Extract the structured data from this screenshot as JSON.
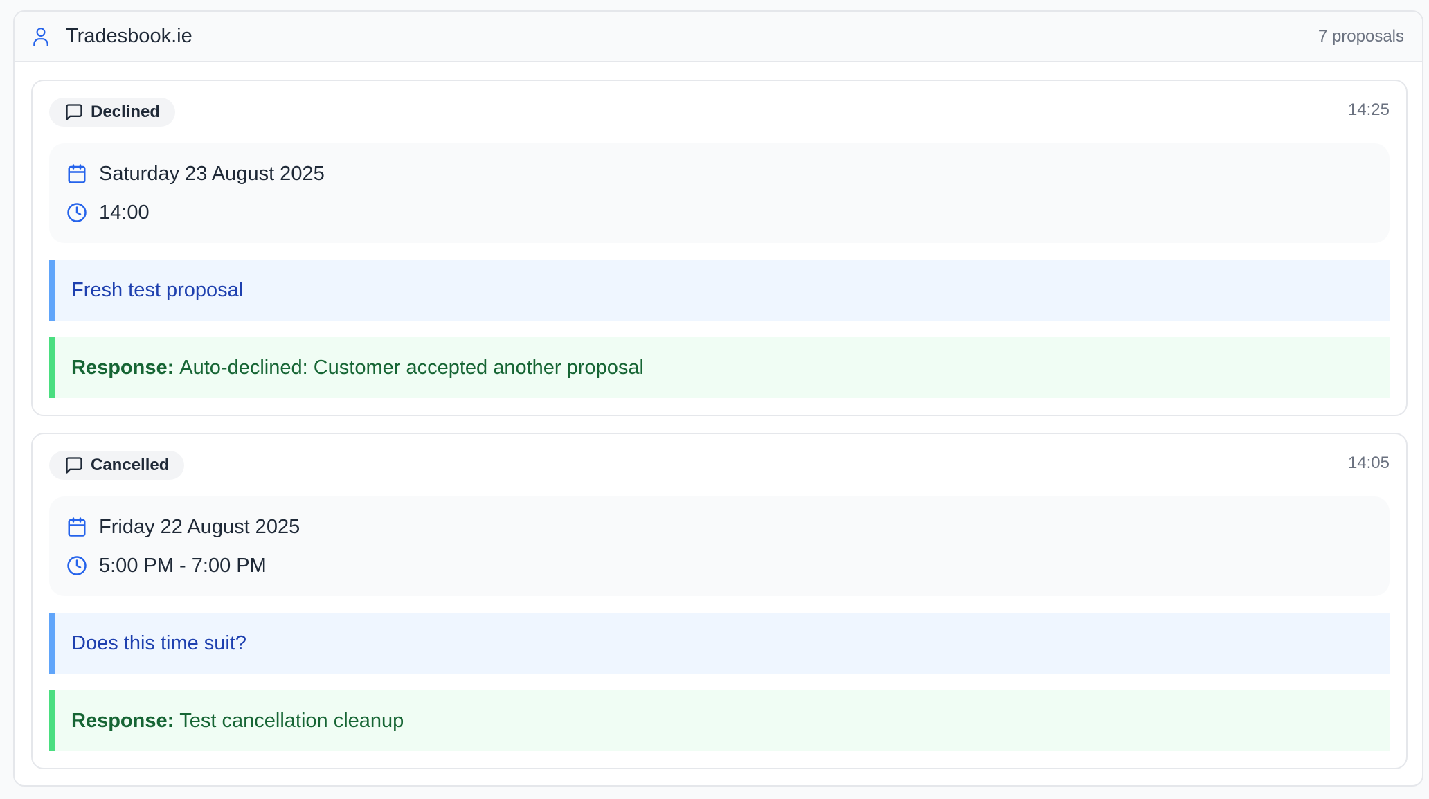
{
  "header": {
    "title": "Tradesbook.ie",
    "count": "7 proposals",
    "icon": "user-icon"
  },
  "colors": {
    "accent_blue": "#2563eb",
    "message_bg": "#eff6ff",
    "message_border": "#60a5fa",
    "response_bg": "#f0fdf4",
    "response_border": "#4ade80"
  },
  "proposals": [
    {
      "status": "Declined",
      "sent_time": "14:25",
      "date": "Saturday 23 August 2025",
      "time": "14:00",
      "message": "Fresh test proposal",
      "response_label": "Response:",
      "response_text": "Auto-declined: Customer accepted another proposal"
    },
    {
      "status": "Cancelled",
      "sent_time": "14:05",
      "date": "Friday 22 August 2025",
      "time": "5:00 PM - 7:00 PM",
      "message": "Does this time suit?",
      "response_label": "Response:",
      "response_text": "Test cancellation cleanup"
    }
  ]
}
